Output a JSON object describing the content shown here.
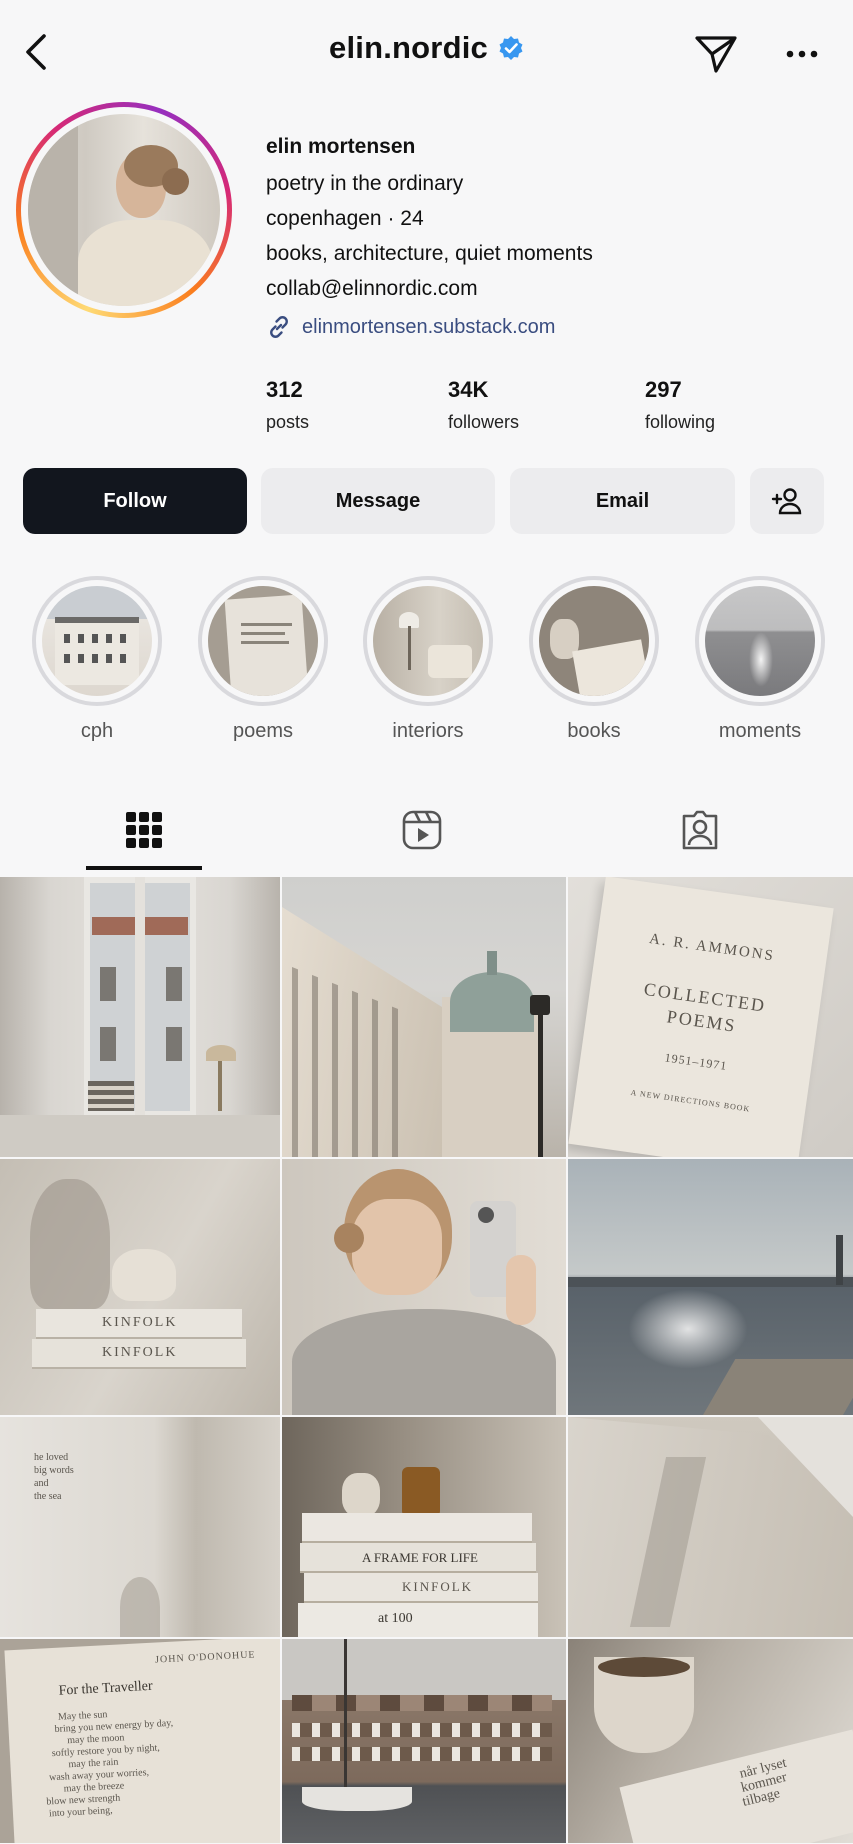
{
  "header": {
    "username": "elin.nordic",
    "verified_icon": "verified-badge-icon",
    "back_icon": "chevron-left-icon",
    "send_icon": "paper-plane-icon",
    "more_icon": "more-dots-icon"
  },
  "profile": {
    "name": "elin mortensen",
    "bio_lines": [
      "poetry in the ordinary",
      "copenhagen · 24",
      "books, architecture, quiet moments",
      "collab@elinnordic.com"
    ],
    "link": "elinmortensen.substack.com"
  },
  "stats": {
    "posts": {
      "value": "312",
      "label": "posts"
    },
    "followers": {
      "value": "34K",
      "label": "followers"
    },
    "following": {
      "value": "297",
      "label": "following"
    }
  },
  "actions": {
    "follow": "Follow",
    "message": "Message",
    "email": "Email"
  },
  "highlights": [
    {
      "label": "cph"
    },
    {
      "label": "poems"
    },
    {
      "label": "interiors"
    },
    {
      "label": "books"
    },
    {
      "label": "moments"
    }
  ],
  "posts_text": {
    "book_author": "A. R. AMMONS",
    "book_title_1": "COLLECTED",
    "book_title_2": "POEMS",
    "book_years": "1951–1971",
    "book_publisher": "A NEW DIRECTIONS BOOK",
    "kinfolk": "KINFOLK",
    "poem_lines": [
      "he loved",
      "big words",
      "and",
      "the sea"
    ],
    "stack_titles": [
      "A FRAME FOR LIFE",
      "KINFOLK",
      "at 100"
    ],
    "page_author": "JOHN O'DONOHUE",
    "page_title": "For the Traveller",
    "page_lines": [
      "May the sun",
      "bring you new energy by day,",
      "may the moon",
      "softly restore you by night,",
      "may the rain",
      "wash away your worries,",
      "may the breeze",
      "blow new strength",
      "into your being,"
    ],
    "danish_lines": [
      "når lyset",
      "kommer",
      "tilbage"
    ]
  },
  "colors": {
    "follow_bg": "#12161e",
    "button_bg": "#ececee",
    "link": "#3a4d80",
    "verified": "#3897f0"
  }
}
